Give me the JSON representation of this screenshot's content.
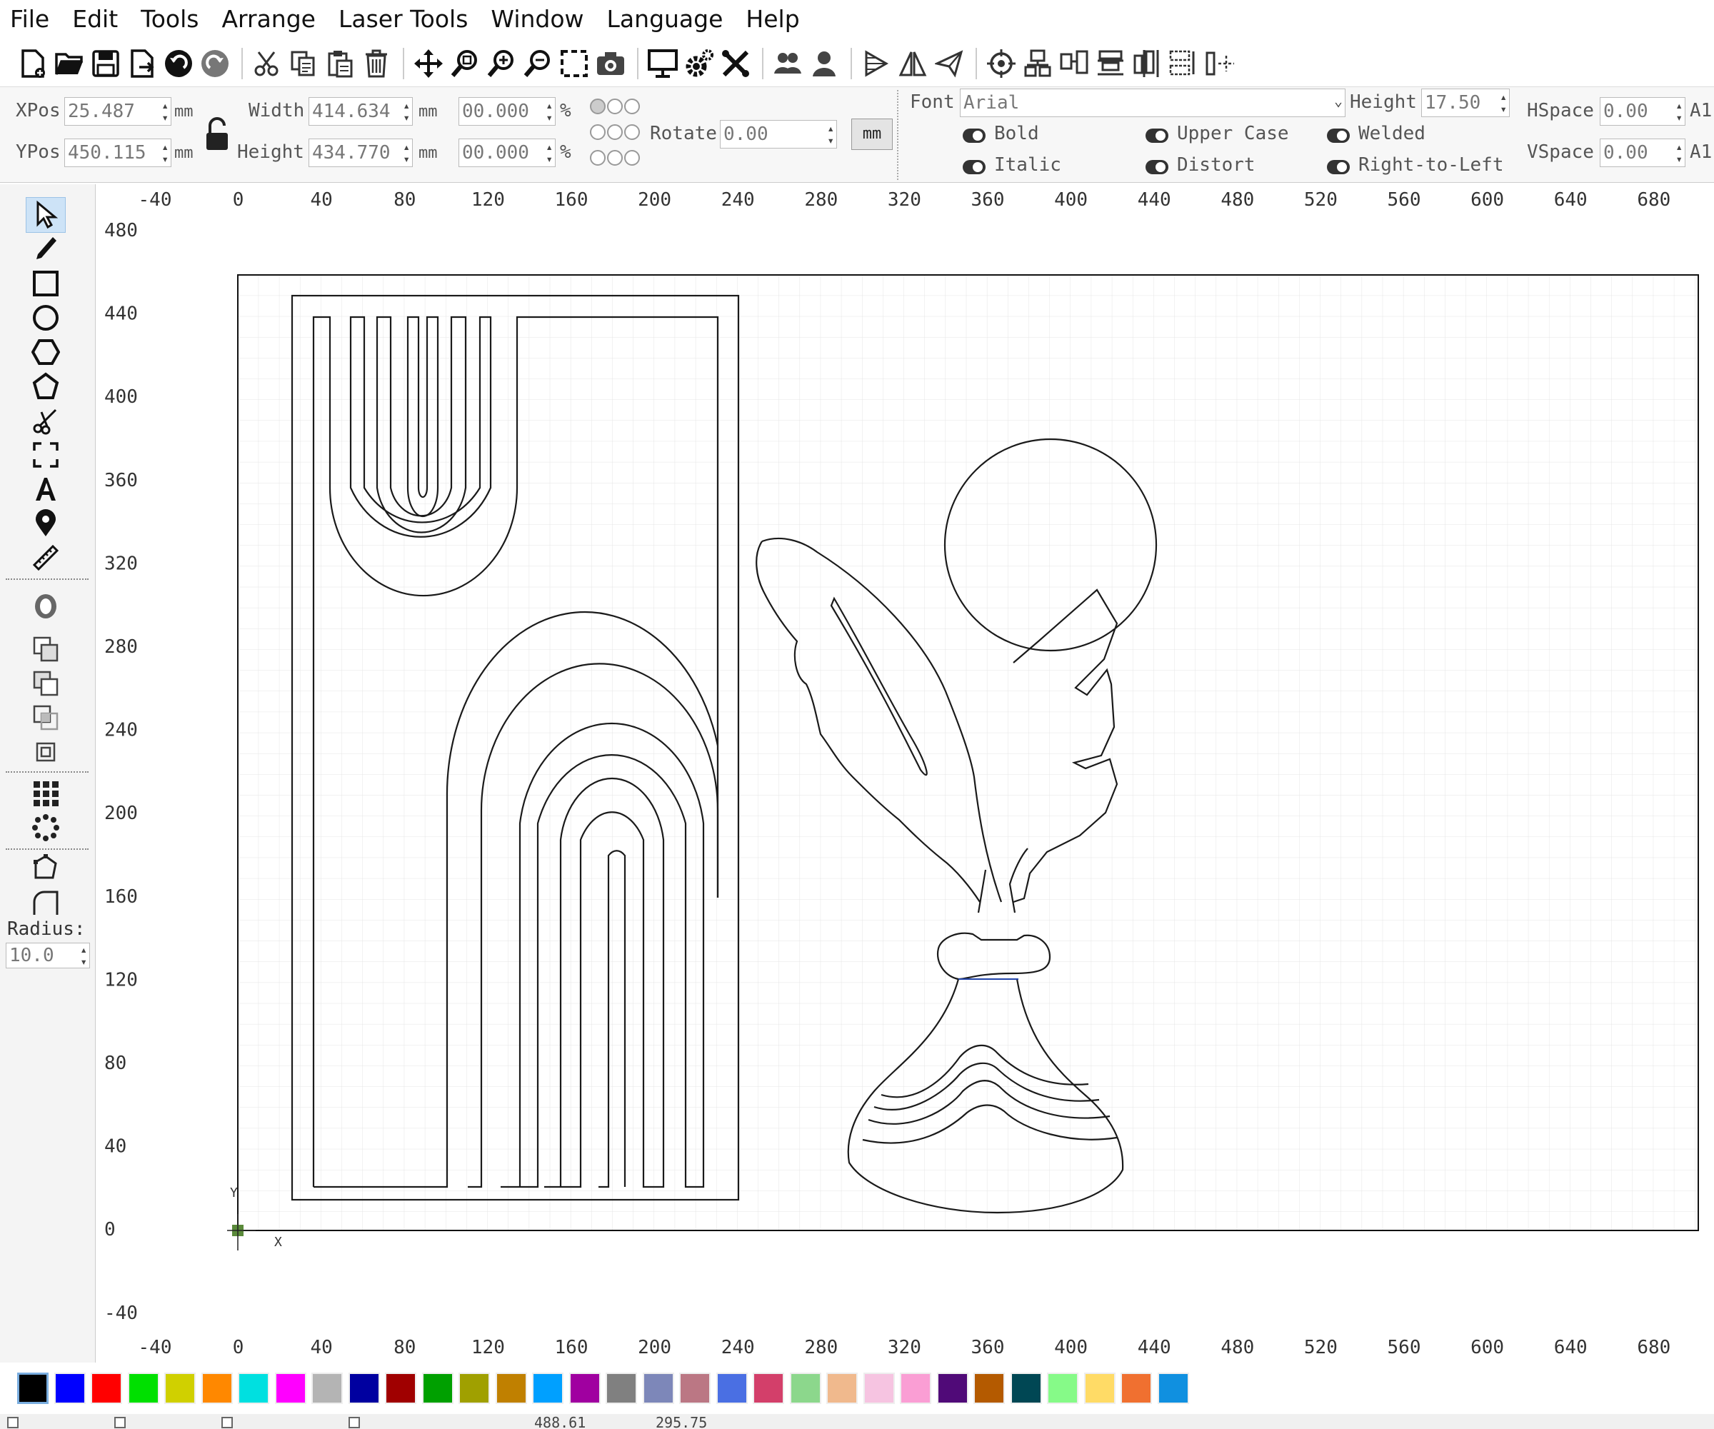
{
  "menu": [
    "File",
    "Edit",
    "Tools",
    "Arrange",
    "Laser Tools",
    "Window",
    "Language",
    "Help"
  ],
  "toolbar_icons": [
    "new-file",
    "open-folder",
    "save",
    "export",
    "undo",
    "redo",
    "cut",
    "copy",
    "paste",
    "delete",
    "move",
    "zoom-fit",
    "zoom-in",
    "zoom-out",
    "select-frame",
    "camera",
    "monitor",
    "settings",
    "tools",
    "group",
    "user",
    "mirror-h",
    "mirror-v",
    "send",
    "target",
    "align-top",
    "align-center",
    "distribute-h",
    "distribute-v",
    "center-h",
    "center-v"
  ],
  "props": {
    "xpos_label": "XPos",
    "xpos_value": "25.487",
    "xpos_unit": "mm",
    "ypos_label": "YPos",
    "ypos_value": "450.115",
    "ypos_unit": "mm",
    "width_label": "Width",
    "width_value": "414.634",
    "width_unit": "mm",
    "height_label": "Height",
    "height_value": "434.770",
    "height_unit": "mm",
    "scale_w": "00.000",
    "scale_h": "00.000",
    "percent": "%",
    "rotate_label": "Rotate",
    "rotate_value": "0.00",
    "unit_button": "mm"
  },
  "font": {
    "font_label": "Font",
    "font_value": "Arial",
    "height_label": "Height",
    "height_value": "17.50",
    "hspace_label": "HSpace",
    "hspace_value": "0.00",
    "vspace_label": "VSpace",
    "vspace_value": "0.00",
    "align_h": "A1",
    "align_v": "A1",
    "bold": "Bold",
    "italic": "Italic",
    "upper_case": "Upper Case",
    "distort": "Distort",
    "welded": "Welded",
    "right_to_left": "Right-to-Left"
  },
  "toolbox": {
    "tools": [
      "select-arrow",
      "pencil",
      "rectangle",
      "ellipse",
      "polygon",
      "pentagon",
      "scissors",
      "frame",
      "text",
      "position-marker",
      "measure-ruler",
      "offset",
      "boolean-union",
      "boolean-subtract",
      "boolean-intersect",
      "boolean-weld",
      "grid-array",
      "circular-array",
      "node-edit",
      "corner-round"
    ],
    "radius_label": "Radius:",
    "radius_value": "10.0"
  },
  "ruler": {
    "x_ticks": [
      "-40",
      "0",
      "40",
      "80",
      "120",
      "160",
      "200",
      "240",
      "280",
      "320",
      "360",
      "400",
      "440",
      "480",
      "520",
      "560",
      "600",
      "640",
      "680"
    ],
    "y_ticks": [
      "480",
      "440",
      "400",
      "360",
      "320",
      "280",
      "240",
      "200",
      "160",
      "120",
      "80",
      "40",
      "0",
      "-40"
    ],
    "origin_x_label": "X",
    "origin_y_label": "Y"
  },
  "palette": [
    "#000000",
    "#0000ff",
    "#ff0000",
    "#00e000",
    "#d0d000",
    "#ff8800",
    "#00e0e0",
    "#ff00ff",
    "#b4b4b4",
    "#0000a0",
    "#a00000",
    "#00a000",
    "#a0a000",
    "#c08000",
    "#00a0ff",
    "#a000a0",
    "#808080",
    "#7d87b9",
    "#bb7784",
    "#4a6fe3",
    "#d33f6a",
    "#8cd78c",
    "#f0b98d",
    "#f6c4e1",
    "#fa9ed4",
    "#500a78",
    "#b45a00",
    "#004754",
    "#86fa88",
    "#ffdb66",
    "#f07030",
    "#1090e0"
  ],
  "status": {
    "coords_x": "488.61",
    "coords_y": "295.75"
  }
}
